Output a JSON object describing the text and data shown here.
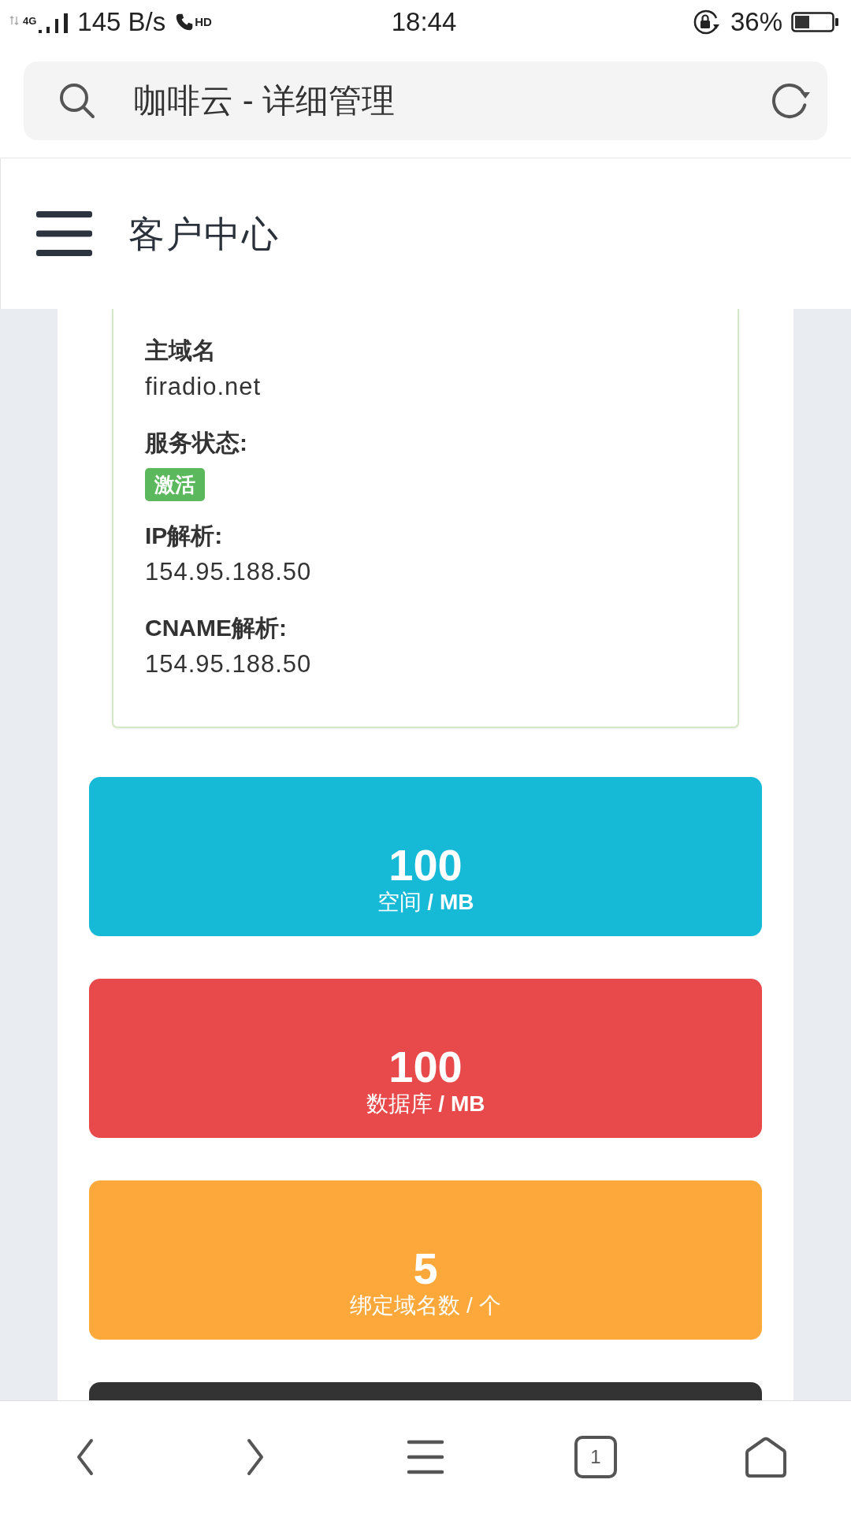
{
  "status_bar": {
    "network_type": "4G",
    "data_speed": "145 B/s",
    "call_badge": "HD",
    "time": "18:44",
    "battery_percent": "36%"
  },
  "browser_bar": {
    "page_title": "咖啡云 - 详细管理"
  },
  "app_header": {
    "title": "客户中心"
  },
  "details": [
    {
      "kind": "text",
      "label": "主域名",
      "value": "firadio.net"
    },
    {
      "kind": "badge",
      "label": "服务状态:",
      "value": "激活"
    },
    {
      "kind": "text",
      "label": "IP解析:",
      "value": "154.95.188.50"
    },
    {
      "kind": "text",
      "label": "CNAME解析:",
      "value": "154.95.188.50"
    }
  ],
  "stats": [
    {
      "value": "100",
      "label": "空间 **/ MB**",
      "color": "#16b9d6"
    },
    {
      "value": "100",
      "label": "数据库 **/ MB**",
      "color": "#e84a4b"
    },
    {
      "value": "5",
      "label": "绑定域名数 / 个",
      "color": "#fda83b"
    },
    {
      "color": "#333333"
    }
  ],
  "bottom_nav": {
    "tab_count": "1"
  }
}
